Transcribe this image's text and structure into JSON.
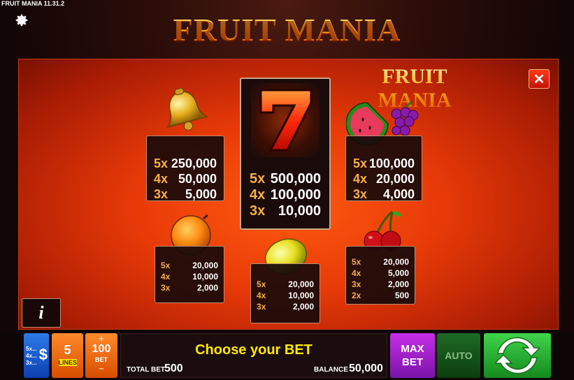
{
  "header": {
    "version": "FRUIT MANIA 11.31.2",
    "logo": "FRUIT MANIA"
  },
  "paytable": {
    "logo": "FRUIT MANIA",
    "close_label": "✕",
    "info_label": "i",
    "symbols": [
      {
        "name": "bell",
        "icon": "bell-icon",
        "pays": [
          {
            "m": "5x",
            "v": "250,000"
          },
          {
            "m": "4x",
            "v": "50,000"
          },
          {
            "m": "3x",
            "v": "5,000"
          }
        ]
      },
      {
        "name": "seven",
        "icon": "seven-icon",
        "seven_label": "7",
        "pays": [
          {
            "m": "5x",
            "v": "500,000"
          },
          {
            "m": "4x",
            "v": "100,000"
          },
          {
            "m": "3x",
            "v": "10,000"
          }
        ]
      },
      {
        "name": "melon-grapes",
        "icon": "watermelon-grapes-icon",
        "pays": [
          {
            "m": "5x",
            "v": "100,000"
          },
          {
            "m": "4x",
            "v": "20,000"
          },
          {
            "m": "3x",
            "v": "4,000"
          }
        ]
      },
      {
        "name": "orange",
        "icon": "orange-icon",
        "pays": [
          {
            "m": "5x",
            "v": "20,000"
          },
          {
            "m": "4x",
            "v": "10,000"
          },
          {
            "m": "3x",
            "v": "2,000"
          }
        ]
      },
      {
        "name": "lemon",
        "icon": "lemon-icon",
        "pays": [
          {
            "m": "5x",
            "v": "20,000"
          },
          {
            "m": "4x",
            "v": "10,000"
          },
          {
            "m": "3x",
            "v": "2,000"
          }
        ]
      },
      {
        "name": "cherry",
        "icon": "cherry-icon",
        "pays": [
          {
            "m": "5x",
            "v": "20,000"
          },
          {
            "m": "4x",
            "v": "5,000"
          },
          {
            "m": "3x",
            "v": "2,000"
          },
          {
            "m": "2x",
            "v": "500"
          }
        ]
      }
    ]
  },
  "bottom": {
    "paytable_btn": {
      "lines": [
        "5x...",
        "4x...",
        "3x..."
      ],
      "symbol": "$"
    },
    "lines": {
      "value": "5",
      "label": "LINES"
    },
    "bet": {
      "plus": "+",
      "value": "100",
      "label": "BET",
      "minus": "–"
    },
    "message": "Choose your BET",
    "total_bet_label": "TOTAL BET",
    "total_bet": "500",
    "balance_label": "BALANCE",
    "balance": "50,000",
    "max_bet": [
      "MAX",
      "BET"
    ],
    "auto": "AUTO"
  },
  "colors": {
    "multiplier": "#f6b04a",
    "message": "#ffe800",
    "max_bet": "#a020d0",
    "spin": "#2ec43a"
  }
}
